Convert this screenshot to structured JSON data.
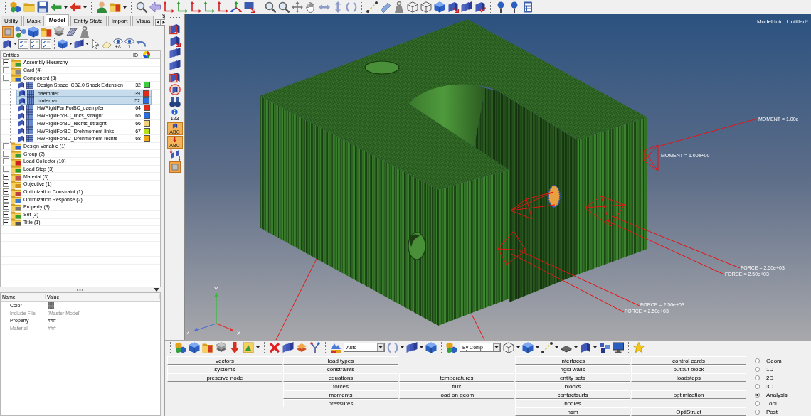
{
  "left_panel": {
    "tabs": [
      {
        "label": "Utility",
        "selected": false
      },
      {
        "label": "Mask",
        "selected": false
      },
      {
        "label": "Model",
        "selected": true
      },
      {
        "label": "Entity State",
        "selected": false
      },
      {
        "label": "Import",
        "selected": false
      },
      {
        "label": "Visua",
        "selected": false
      }
    ],
    "toolbar_captions": [
      "+/-",
      "1"
    ],
    "entities": {
      "columns": [
        "Entities",
        "ID"
      ],
      "items": [
        {
          "label": "Assembly Hierarchy",
          "expanded": false,
          "selected": false
        },
        {
          "label": "Card (4)",
          "expanded": false,
          "selected": false
        },
        {
          "label": "Component (8)",
          "expanded": true,
          "selected": false,
          "children": [
            {
              "label": "Design Space ICB2.0 Shock Extension",
              "id": "32",
              "color": "#3fcc3f",
              "selected": false
            },
            {
              "label": "daempfer",
              "id": "39",
              "color": "#e02a1a",
              "selected": true
            },
            {
              "label": "hinterbau",
              "id": "52",
              "color": "#2a6de0",
              "selected": true
            },
            {
              "label": "HWRigidPartForBC_daempfer",
              "id": "64",
              "color": "#e02a1a",
              "selected": false
            },
            {
              "label": "HWRigidForBC_links_straight",
              "id": "65",
              "color": "#2a6de0",
              "selected": false
            },
            {
              "label": "HWRigidForBC_rechts_straight",
              "id": "66",
              "color": "#f0d27a",
              "selected": false
            },
            {
              "label": "HWRigidForBC_Drehmoment links",
              "id": "67",
              "color": "#b8e01a",
              "selected": false
            },
            {
              "label": "HWRigidForBC_Drehmoment rechts",
              "id": "68",
              "color": "#f0a818",
              "selected": false
            }
          ]
        },
        {
          "label": "Design Variable (1)",
          "expanded": false,
          "selected": false
        },
        {
          "label": "Group (2)",
          "expanded": false,
          "selected": false
        },
        {
          "label": "Load Collector (10)",
          "expanded": false,
          "selected": false
        },
        {
          "label": "Load Step (3)",
          "expanded": false,
          "selected": false
        },
        {
          "label": "Material (3)",
          "expanded": false,
          "selected": false
        },
        {
          "label": "Objective (1)",
          "expanded": false,
          "selected": false
        },
        {
          "label": "Optimization Constraint (1)",
          "expanded": false,
          "selected": false
        },
        {
          "label": "Optimization Response (2)",
          "expanded": false,
          "selected": false
        },
        {
          "label": "Property (3)",
          "expanded": false,
          "selected": false
        },
        {
          "label": "Set (3)",
          "expanded": false,
          "selected": false
        },
        {
          "label": "Title (1)",
          "expanded": false,
          "selected": false
        }
      ]
    },
    "properties": {
      "columns": [
        "Name",
        "Value"
      ],
      "rows": [
        {
          "name": "Color",
          "kind": "swatch",
          "disabled": false
        },
        {
          "name": "Include File",
          "kind": "text",
          "value": "[Master Model]",
          "disabled": true
        },
        {
          "name": "Property",
          "kind": "text",
          "value": "###",
          "disabled": false
        },
        {
          "name": "Material",
          "kind": "text",
          "value": "###",
          "disabled": true
        }
      ]
    }
  },
  "vertical_toolbar": {
    "captions": [
      "123",
      "ABC",
      "ABC"
    ]
  },
  "viewport": {
    "model_info": "Model Info: Untitled*",
    "load_labels": [
      "MOMENT = 1.00e+",
      "MOMENT = 1.00e+00",
      "FORCE = 2.50e+03",
      "FORCE = 2.50e+03",
      "FORCE = 2.50e+03",
      "FORCE = 2.50e+03"
    ],
    "axis_labels": [
      "Y",
      "Z",
      "X"
    ]
  },
  "bottom_toolbar": {
    "dropdowns": [
      {
        "value": "Auto"
      },
      {
        "value": "By Comp"
      }
    ]
  },
  "panel": {
    "rows": [
      {
        "cells": [
          {
            "kind": "button",
            "label": "vectors"
          },
          {
            "kind": "button",
            "label": "load types"
          },
          {
            "kind": "empty"
          },
          {
            "kind": "button",
            "label": "interfaces"
          },
          {
            "kind": "button",
            "label": "control cards"
          }
        ]
      },
      {
        "cells": [
          {
            "kind": "button",
            "label": "systems"
          },
          {
            "kind": "button",
            "label": "constraints"
          },
          {
            "kind": "empty"
          },
          {
            "kind": "button",
            "label": "rigid walls"
          },
          {
            "kind": "button",
            "label": "output block"
          }
        ]
      },
      {
        "cells": [
          {
            "kind": "button",
            "label": "preserve node"
          },
          {
            "kind": "button",
            "label": "equations"
          },
          {
            "kind": "button",
            "label": "temperatures"
          },
          {
            "kind": "button",
            "label": "entity sets"
          },
          {
            "kind": "button",
            "label": "loadsteps"
          }
        ]
      },
      {
        "cells": [
          {
            "kind": "empty"
          },
          {
            "kind": "button",
            "label": "forces"
          },
          {
            "kind": "button",
            "label": "flux"
          },
          {
            "kind": "button",
            "label": "blocks"
          },
          {
            "kind": "empty"
          }
        ]
      },
      {
        "cells": [
          {
            "kind": "empty"
          },
          {
            "kind": "button",
            "label": "moments"
          },
          {
            "kind": "button",
            "label": "load on geom"
          },
          {
            "kind": "button",
            "label": "contactsurfs"
          },
          {
            "kind": "button",
            "label": "optimization"
          }
        ]
      },
      {
        "cells": [
          {
            "kind": "empty"
          },
          {
            "kind": "button",
            "label": "pressures"
          },
          {
            "kind": "empty"
          },
          {
            "kind": "button",
            "label": "bodies"
          },
          {
            "kind": "empty"
          }
        ]
      },
      {
        "cells": [
          {
            "kind": "empty"
          },
          {
            "kind": "empty"
          },
          {
            "kind": "empty"
          },
          {
            "kind": "button",
            "label": "nsm"
          },
          {
            "kind": "button",
            "label": "OptiStruct"
          }
        ]
      }
    ],
    "modes": [
      {
        "label": "Geom",
        "selected": false
      },
      {
        "label": "1D",
        "selected": false
      },
      {
        "label": "2D",
        "selected": false
      },
      {
        "label": "3D",
        "selected": false
      },
      {
        "label": "Analysis",
        "selected": true
      },
      {
        "label": "Tool",
        "selected": false
      },
      {
        "label": "Post",
        "selected": false
      }
    ]
  }
}
